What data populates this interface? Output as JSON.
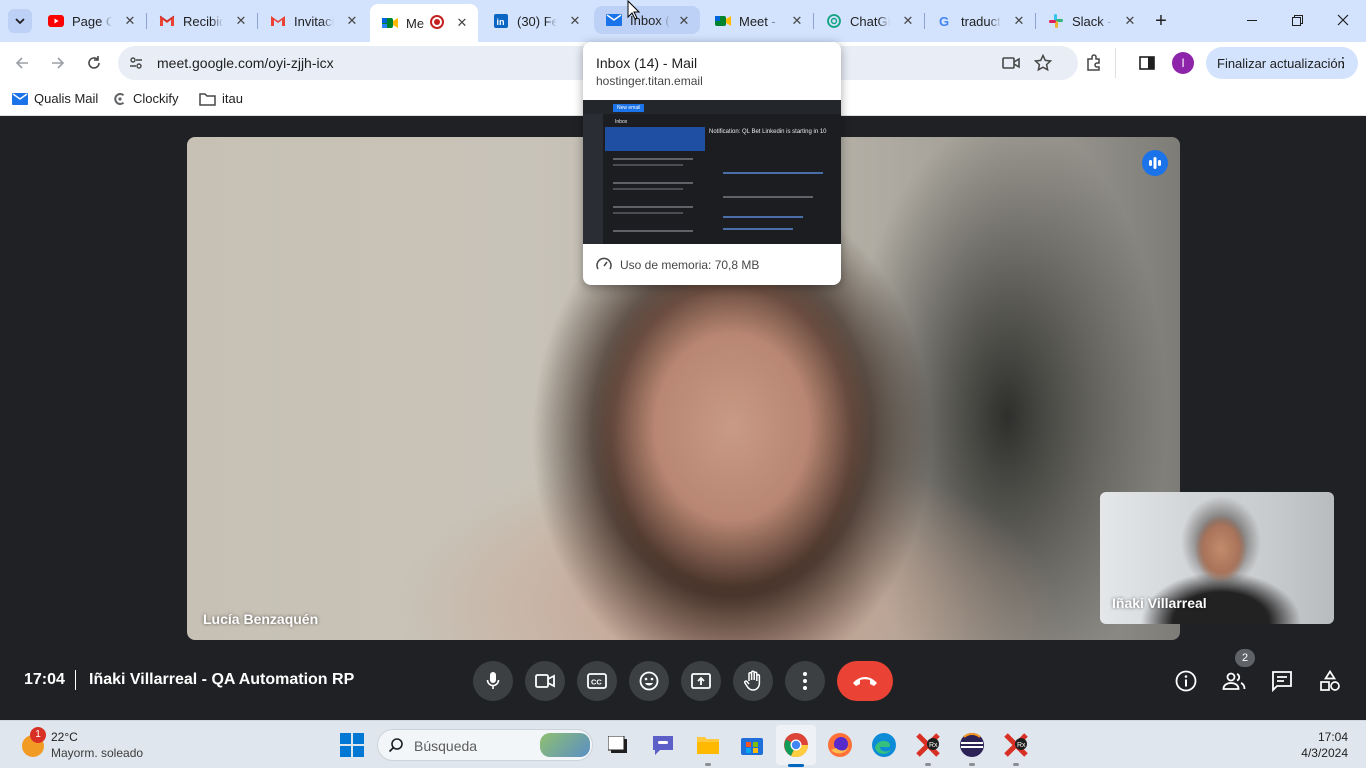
{
  "browser": {
    "tabs": [
      {
        "label": "Page Ol",
        "icon": "youtube-icon"
      },
      {
        "label": "Recibid",
        "icon": "gmail-icon"
      },
      {
        "label": "Invitaci",
        "icon": "gmail-icon"
      },
      {
        "label": "Me",
        "icon": "meet-icon",
        "active": true,
        "recording": true
      },
      {
        "label": "(30) Fe",
        "icon": "linkedin-icon"
      },
      {
        "label": "Inbox (",
        "icon": "mail-icon",
        "hover": true
      },
      {
        "label": "Meet -",
        "icon": "meet-icon"
      },
      {
        "label": "ChatGP",
        "icon": "chatgpt-icon"
      },
      {
        "label": "traduct",
        "icon": "google-icon"
      },
      {
        "label": "Slack -",
        "icon": "slack-icon"
      }
    ],
    "url": "meet.google.com/oyi-zjjh-icx",
    "update_button": "Finalizar actualización",
    "profile_initial": "I",
    "bookmarks": [
      {
        "label": "Qualis Mail",
        "icon": "mail-icon"
      },
      {
        "label": "Clockify",
        "icon": "clockify-icon"
      },
      {
        "label": "itau",
        "icon": "folder-icon"
      }
    ]
  },
  "tab_preview": {
    "title": "Inbox (14) - Mail",
    "domain": "hostinger.titan.email",
    "memory": "Uso de memoria: 70,8 MB",
    "thumb_header": "Notification: QL Bet Linkedin is starting in 10",
    "thumb_folder": "Inbox",
    "thumb_button": "New email"
  },
  "meet": {
    "main_participant": "Lucía Benzaquén",
    "self_participant": "Iñaki Villarreal",
    "time": "17:04",
    "meeting_title": "Iñaki Villarreal - QA Automation RP",
    "participants_count": "2"
  },
  "taskbar": {
    "weather_badge": "1",
    "temperature": "22°C",
    "weather_desc": "Mayorm. soleado",
    "search_placeholder": "Búsqueda",
    "clock_time": "17:04",
    "clock_date": "4/3/2024"
  },
  "colors": {
    "tabstrip": "#d3e3fd",
    "hangup": "#ea4335",
    "meet_bg": "#202124",
    "accent": "#0b57d0"
  }
}
